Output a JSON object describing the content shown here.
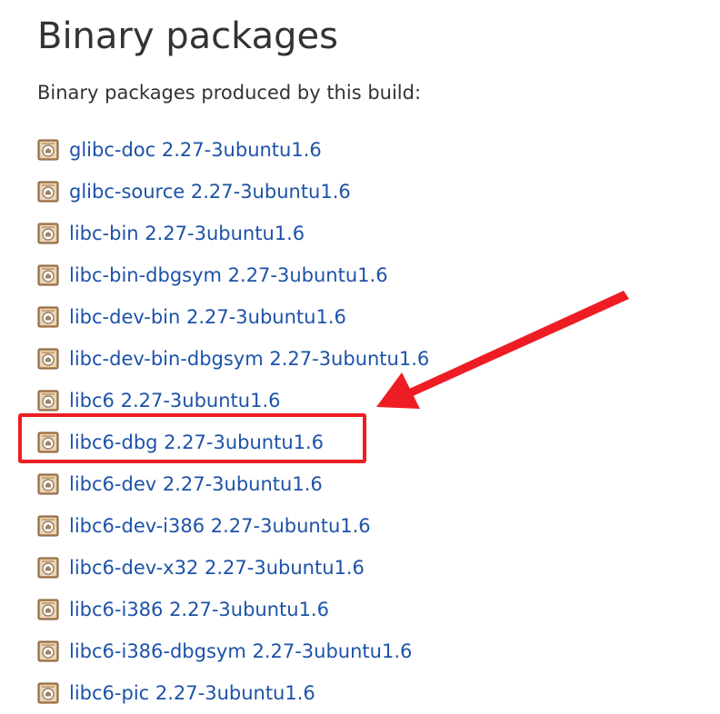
{
  "heading": "Binary packages",
  "intro": "Binary packages produced by this build:",
  "packages": [
    {
      "label": "glibc-doc 2.27-3ubuntu1.6"
    },
    {
      "label": "glibc-source 2.27-3ubuntu1.6"
    },
    {
      "label": "libc-bin 2.27-3ubuntu1.6"
    },
    {
      "label": "libc-bin-dbgsym 2.27-3ubuntu1.6"
    },
    {
      "label": "libc-dev-bin 2.27-3ubuntu1.6"
    },
    {
      "label": "libc-dev-bin-dbgsym 2.27-3ubuntu1.6"
    },
    {
      "label": "libc6 2.27-3ubuntu1.6"
    },
    {
      "label": "libc6-dbg 2.27-3ubuntu1.6",
      "highlighted": true
    },
    {
      "label": "libc6-dev 2.27-3ubuntu1.6"
    },
    {
      "label": "libc6-dev-i386 2.27-3ubuntu1.6"
    },
    {
      "label": "libc6-dev-x32 2.27-3ubuntu1.6"
    },
    {
      "label": "libc6-i386 2.27-3ubuntu1.6"
    },
    {
      "label": "libc6-i386-dbgsym 2.27-3ubuntu1.6"
    },
    {
      "label": "libc6-pic 2.27-3ubuntu1.6"
    }
  ],
  "package_icon": "package-icon",
  "colors": {
    "link": "#1d52a8",
    "text": "#333333",
    "annotation": "#ee1d23"
  }
}
